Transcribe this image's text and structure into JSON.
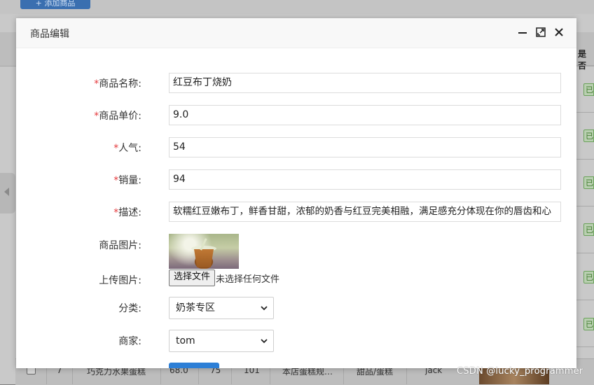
{
  "background": {
    "add_button": "+ 添加商品",
    "column_header": "是否",
    "tag_text": "已",
    "bottom_row": {
      "id": "7",
      "name": "巧克力水果蛋糕",
      "price": "68.0",
      "popularity": "75",
      "sales": "101",
      "desc": "本店蛋糕规…",
      "category": "甜品/蛋糕",
      "merchant": "jack"
    }
  },
  "modal": {
    "title": "商品编辑",
    "fields": {
      "name_label": "商品名称:",
      "name_value": "红豆布丁烧奶",
      "price_label": "商品单价:",
      "price_value": "9.0",
      "popularity_label": "人气:",
      "popularity_value": "54",
      "sales_label": "销量:",
      "sales_value": "94",
      "desc_label": "描述:",
      "desc_value": "软糯红豆嫩布丁，鲜香甘甜，浓郁的奶香与红豆完美相融，满足感充分体现在你的唇齿和心",
      "image_label": "商品图片:",
      "upload_label": "上传图片:",
      "upload_button": "选择文件",
      "upload_status": "未选择任何文件",
      "category_label": "分类:",
      "category_value": "奶茶专区",
      "merchant_label": "商家:",
      "merchant_value": "tom"
    },
    "required_mark": "*"
  },
  "watermark": "CSDN @lucky_programmer",
  "icons": {
    "minimize": "minimize-icon",
    "maximize": "maximize-icon",
    "close": "close-icon",
    "chevron": "chevron-down-icon"
  },
  "colors": {
    "required": "#e4393c",
    "primary": "#2d7fd6",
    "tag_green": "#3d7a2a"
  }
}
